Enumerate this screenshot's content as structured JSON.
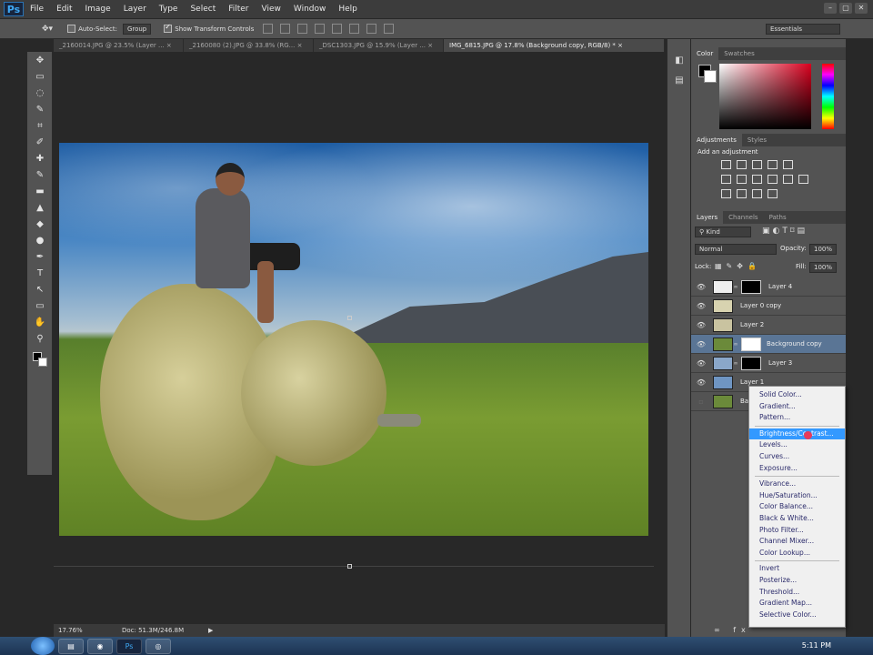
{
  "app": {
    "logo": "Ps",
    "menu": [
      "File",
      "Edit",
      "Image",
      "Layer",
      "Type",
      "Select",
      "Filter",
      "View",
      "Window",
      "Help"
    ],
    "window_controls": [
      "–",
      "▢",
      "✕"
    ]
  },
  "options_bar": {
    "auto_select_label": "Auto-Select:",
    "auto_select_value": "Group",
    "show_transform_label": "Show Transform Controls",
    "workspace": "Essentials"
  },
  "tabs": [
    {
      "label": "_2160014.JPG @ 23.5% (Layer ...",
      "close": "×"
    },
    {
      "label": "_2160080 (2).JPG @ 33.8% (RG...",
      "close": "×"
    },
    {
      "label": "_DSC1303.JPG @ 15.9% (Layer ...",
      "close": "×"
    },
    {
      "label": "IMG_6815.JPG @ 17.8% (Background copy, RGB/8) *",
      "close": "×"
    }
  ],
  "tools": [
    "✥",
    "▭",
    "◌",
    "✎",
    "⌗",
    "✐",
    "✚",
    "✎",
    "▬",
    "▲",
    "◆",
    "●",
    "✒",
    "T",
    "↖",
    "▭",
    "✋",
    "⚲"
  ],
  "status": {
    "zoom": "17.76%",
    "doc": "Doc: 51.3M/246.8M"
  },
  "color_panel": {
    "tabs": [
      "Color",
      "Swatches"
    ]
  },
  "adjustments_panel": {
    "tabs": [
      "Adjustments",
      "Styles"
    ],
    "heading": "Add an adjustment"
  },
  "layers_panel": {
    "tabs": [
      "Layers",
      "Channels",
      "Paths"
    ],
    "kind": "Kind",
    "blend_mode": "Normal",
    "opacity_label": "Opacity:",
    "opacity": "100%",
    "lock_label": "Lock:",
    "fill_label": "Fill:",
    "fill": "100%",
    "layers": [
      {
        "name": "Layer 4",
        "selected": false,
        "mask": true
      },
      {
        "name": "Layer 0 copy",
        "selected": false,
        "mask": false
      },
      {
        "name": "Layer 2",
        "selected": false,
        "mask": false
      },
      {
        "name": "Background copy",
        "selected": true,
        "mask": true
      },
      {
        "name": "Layer 3",
        "selected": false,
        "mask": true
      },
      {
        "name": "Layer 1",
        "selected": false,
        "mask": false
      },
      {
        "name": "Bac",
        "selected": false,
        "mask": false
      }
    ]
  },
  "context_menu": {
    "groups": [
      [
        "Solid Color...",
        "Gradient...",
        "Pattern..."
      ],
      [
        "Brightness/Contrast...",
        "Levels...",
        "Curves...",
        "Exposure..."
      ],
      [
        "Vibrance...",
        "Hue/Saturation...",
        "Color Balance...",
        "Black & White...",
        "Photo Filter...",
        "Channel Mixer...",
        "Color Lookup..."
      ],
      [
        "Invert",
        "Posterize...",
        "Threshold...",
        "Gradient Map...",
        "Selective Color..."
      ]
    ],
    "highlighted": "Brightness/Contrast..."
  },
  "taskbar": {
    "clock": "5:11 PM",
    "apps": [
      "▤",
      "◉",
      "Ps",
      "◎"
    ]
  }
}
